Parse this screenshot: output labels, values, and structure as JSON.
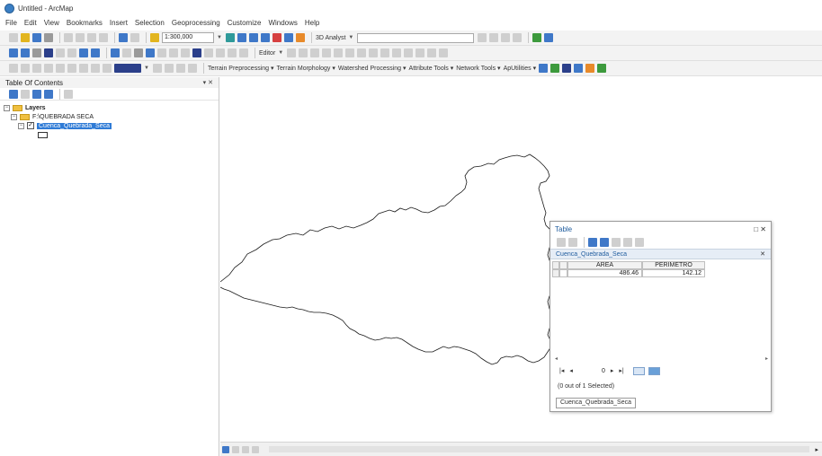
{
  "window": {
    "title": "Untitled - ArcMap"
  },
  "menu": [
    "File",
    "Edit",
    "View",
    "Bookmarks",
    "Insert",
    "Selection",
    "Geoprocessing",
    "Customize",
    "Windows",
    "Help"
  ],
  "toolbar": {
    "scale": "1:300,000",
    "analyst": "3D Analyst",
    "editor": "Editor",
    "tools_row3": [
      "Terrain Preprocessing",
      "Terrain Morphology",
      "Watershed Processing",
      "Attribute Tools",
      "Network Tools",
      "ApUtilities"
    ]
  },
  "toc": {
    "title": "Table Of Contents",
    "controls": " ×",
    "layers_label": "Layers",
    "group_label": "F:\\QUEBRADA SECA",
    "layer_label": "Cuenca_Quebrada_Seca"
  },
  "table": {
    "window_title": "Table",
    "tab_label": "Cuenca_Quebrada_Seca",
    "columns": [
      "AREA",
      "PERIMETRO"
    ],
    "rows": [
      [
        "486.46",
        "142.12"
      ]
    ],
    "record": "0",
    "selection_text": "(0 out of 1 Selected)",
    "footer_tab": "Cuenca_Quebrada_Seca"
  },
  "colors": {
    "selection": "#2f7bd6",
    "accent": "#3f78c8"
  }
}
